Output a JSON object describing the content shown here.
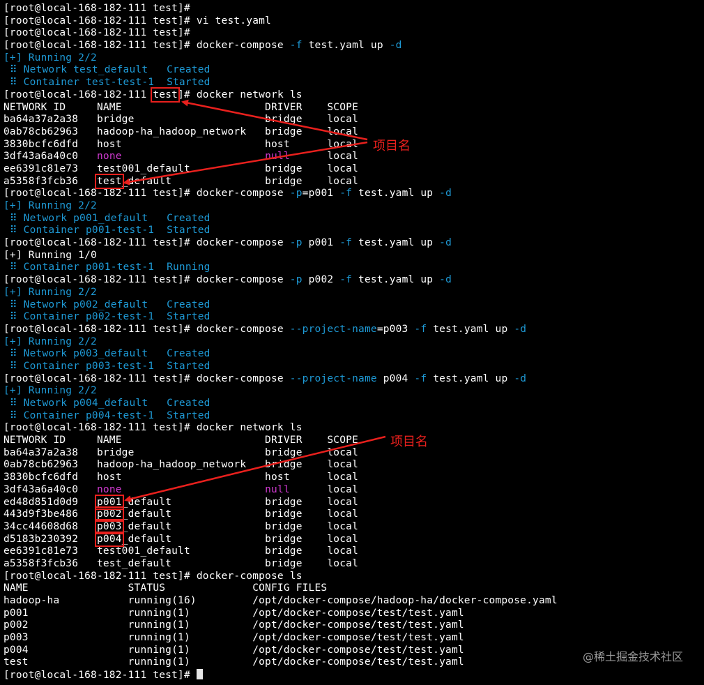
{
  "prompt": "[root@local-168-182-111 test]# ",
  "lines": [
    [
      {
        "t": "[root@local-168-182-111 test]#"
      }
    ],
    [
      {
        "t": "[root@local-168-182-111 test]# vi test.yaml"
      }
    ],
    [
      {
        "t": "[root@local-168-182-111 test]#"
      }
    ],
    [
      {
        "t": "[root@local-168-182-111 test]# docker-compose "
      },
      {
        "t": "-f",
        "c": "blue"
      },
      {
        "t": " test.yaml up "
      },
      {
        "t": "-d",
        "c": "blue"
      }
    ],
    [
      {
        "t": "[+] Running 2/2",
        "c": "blue"
      }
    ],
    [
      {
        "t": " ⠿ Network test_default   Created",
        "c": "blue"
      }
    ],
    [
      {
        "t": " ⠿ Container test-test-1  Started",
        "c": "blue"
      }
    ],
    [
      {
        "t": "[root@local-168-182-111 "
      },
      {
        "t": "test",
        "h": 1
      },
      {
        "t": "]# docker network ls"
      }
    ],
    [
      {
        "t": "NETWORK ID     NAME                       DRIVER    SCOPE"
      }
    ],
    [
      {
        "t": "ba64a37a2a38   bridge                     bridge    local"
      }
    ],
    [
      {
        "t": "0ab78cb62963   hadoop-ha_hadoop_network   bridge    local"
      }
    ],
    [
      {
        "t": "3830bcfc6dfd   host                       host      local"
      }
    ],
    [
      {
        "t": "3df43a6a40c0   "
      },
      {
        "t": "none",
        "c": "mag"
      },
      {
        "t": "                       "
      },
      {
        "t": "null",
        "c": "mag"
      },
      {
        "t": "      local"
      }
    ],
    [
      {
        "t": "ee6391c81e73   test001_default            bridge    local"
      }
    ],
    [
      {
        "t": "a5358f3fcb36   "
      },
      {
        "t": "test",
        "h": 1
      },
      {
        "t": "_default               bridge    local"
      }
    ],
    [
      {
        "t": "[root@local-168-182-111 test]# docker-compose "
      },
      {
        "t": "-p",
        "c": "blue"
      },
      {
        "t": "=p001 "
      },
      {
        "t": "-f",
        "c": "blue"
      },
      {
        "t": " test.yaml up "
      },
      {
        "t": "-d",
        "c": "blue"
      }
    ],
    [
      {
        "t": "[+] Running 2/2",
        "c": "blue"
      }
    ],
    [
      {
        "t": " ⠿ Network p001_default   Created",
        "c": "blue"
      }
    ],
    [
      {
        "t": " ⠿ Container p001-test-1  Started",
        "c": "blue"
      }
    ],
    [
      {
        "t": "[root@local-168-182-111 test]# docker-compose "
      },
      {
        "t": "-p",
        "c": "blue"
      },
      {
        "t": " p001 "
      },
      {
        "t": "-f",
        "c": "blue"
      },
      {
        "t": " test.yaml up "
      },
      {
        "t": "-d",
        "c": "blue"
      }
    ],
    [
      {
        "t": "[+] Running 1/0"
      }
    ],
    [
      {
        "t": " ⠿ Container p001-test-1  Running",
        "c": "blue"
      }
    ],
    [
      {
        "t": "[root@local-168-182-111 test]# docker-compose "
      },
      {
        "t": "-p",
        "c": "blue"
      },
      {
        "t": " p002 "
      },
      {
        "t": "-f",
        "c": "blue"
      },
      {
        "t": " test.yaml up "
      },
      {
        "t": "-d",
        "c": "blue"
      }
    ],
    [
      {
        "t": "[+] Running 2/2",
        "c": "blue"
      }
    ],
    [
      {
        "t": " ⠿ Network p002_default   Created",
        "c": "blue"
      }
    ],
    [
      {
        "t": " ⠿ Container p002-test-1  Started",
        "c": "blue"
      }
    ],
    [
      {
        "t": "[root@local-168-182-111 test]# docker-compose "
      },
      {
        "t": "--project-name",
        "c": "blue"
      },
      {
        "t": "=p003 "
      },
      {
        "t": "-f",
        "c": "blue"
      },
      {
        "t": " test.yaml up "
      },
      {
        "t": "-d",
        "c": "blue"
      }
    ],
    [
      {
        "t": "[+] Running 2/2",
        "c": "blue"
      }
    ],
    [
      {
        "t": " ⠿ Network p003_default   Created",
        "c": "blue"
      }
    ],
    [
      {
        "t": " ⠿ Container p003-test-1  Started",
        "c": "blue"
      }
    ],
    [
      {
        "t": "[root@local-168-182-111 test]# docker-compose "
      },
      {
        "t": "--project-name",
        "c": "blue"
      },
      {
        "t": " p004 "
      },
      {
        "t": "-f",
        "c": "blue"
      },
      {
        "t": " test.yaml up "
      },
      {
        "t": "-d",
        "c": "blue"
      }
    ],
    [
      {
        "t": "[+] Running 2/2",
        "c": "blue"
      }
    ],
    [
      {
        "t": " ⠿ Network p004_default   Created",
        "c": "blue"
      }
    ],
    [
      {
        "t": " ⠿ Container p004-test-1  Started",
        "c": "blue"
      }
    ],
    [
      {
        "t": "[root@local-168-182-111 test]# docker network ls"
      }
    ],
    [
      {
        "t": "NETWORK ID     NAME                       DRIVER    SCOPE"
      }
    ],
    [
      {
        "t": "ba64a37a2a38   bridge                     bridge    local"
      }
    ],
    [
      {
        "t": "0ab78cb62963   hadoop-ha_hadoop_network   bridge    local"
      }
    ],
    [
      {
        "t": "3830bcfc6dfd   host                       host      local"
      }
    ],
    [
      {
        "t": "3df43a6a40c0   "
      },
      {
        "t": "none",
        "c": "mag"
      },
      {
        "t": "                       "
      },
      {
        "t": "null",
        "c": "mag"
      },
      {
        "t": "      local"
      }
    ],
    [
      {
        "t": "ed48d851d0d9   "
      },
      {
        "t": "p001",
        "h": 1
      },
      {
        "t": "_default               bridge    local"
      }
    ],
    [
      {
        "t": "443d9f3be486   "
      },
      {
        "t": "p002",
        "h": 1
      },
      {
        "t": "_default               bridge    local"
      }
    ],
    [
      {
        "t": "34cc44608d68   "
      },
      {
        "t": "p003",
        "h": 1
      },
      {
        "t": "_default               bridge    local"
      }
    ],
    [
      {
        "t": "d5183b230392   "
      },
      {
        "t": "p004",
        "h": 1
      },
      {
        "t": "_default               bridge    local"
      }
    ],
    [
      {
        "t": "ee6391c81e73   test001_default            bridge    local"
      }
    ],
    [
      {
        "t": "a5358f3fcb36   test_default               bridge    local"
      }
    ],
    [
      {
        "t": "[root@local-168-182-111 test]# docker-compose ls"
      }
    ],
    [
      {
        "t": "NAME                STATUS              CONFIG FILES"
      }
    ],
    [
      {
        "t": "hadoop-ha           running(16)         /opt/docker-compose/hadoop-ha/docker-compose.yaml"
      }
    ],
    [
      {
        "t": "p001                running(1)          /opt/docker-compose/test/test.yaml"
      }
    ],
    [
      {
        "t": "p002                running(1)          /opt/docker-compose/test/test.yaml"
      }
    ],
    [
      {
        "t": "p003                running(1)          /opt/docker-compose/test/test.yaml"
      }
    ],
    [
      {
        "t": "p004                running(1)          /opt/docker-compose/test/test.yaml"
      }
    ],
    [
      {
        "t": "test                running(1)          /opt/docker-compose/test/test.yaml"
      }
    ],
    [
      {
        "t": "[root@local-168-182-111 test]# "
      },
      {
        "cursor": 1
      }
    ]
  ],
  "annotations": {
    "label1": "项目名",
    "label2": "项目名"
  },
  "watermark": "@稀土掘金技术社区",
  "colors": {
    "background": "#000000",
    "text": "#ffffff",
    "option_blue": "#1e9ad6",
    "null_magenta": "#d13ad1",
    "annotation_red": "#e8201d"
  }
}
